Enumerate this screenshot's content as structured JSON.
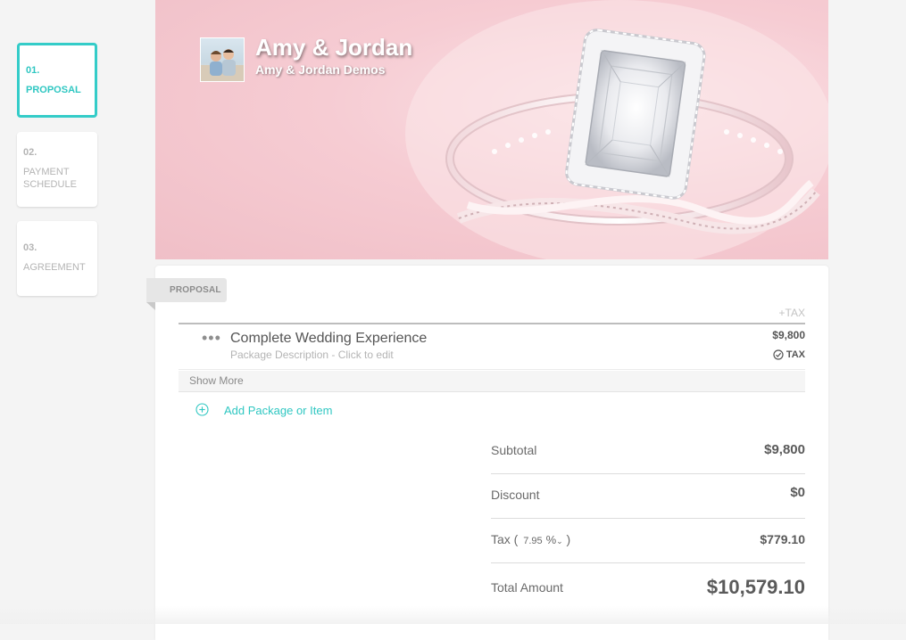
{
  "steps": [
    {
      "num": "01.",
      "label": "PROPOSAL",
      "active": true
    },
    {
      "num": "02.",
      "label": "PAYMENT SCHEDULE",
      "active": false
    },
    {
      "num": "03.",
      "label": "AGREEMENT",
      "active": false
    }
  ],
  "header": {
    "client_name": "Amy & Jordan",
    "client_sub": "Amy & Jordan Demos",
    "avatar_icon": "couple-photo-icon",
    "banner_image": "engagement-ring-photo"
  },
  "proposal": {
    "tab_label": "PROPOSAL",
    "tax_header": "+TAX",
    "items": [
      {
        "title": "Complete Wedding Experience",
        "description": "Package Description - Click to edit",
        "price": "$9,800",
        "tax_label": "TAX"
      }
    ],
    "show_more": "Show More",
    "add_label": "Add Package or Item"
  },
  "totals": {
    "subtotal_label": "Subtotal",
    "subtotal": "$9,800",
    "discount_label": "Discount",
    "discount": "$0",
    "tax_label": "Tax",
    "tax_rate": "7.95",
    "tax_unit": "%",
    "tax": "$779.10",
    "total_label": "Total Amount",
    "total": "$10,579.10"
  },
  "colors": {
    "accent": "#34ccc8",
    "banner_pink": "#f6ccd3"
  }
}
